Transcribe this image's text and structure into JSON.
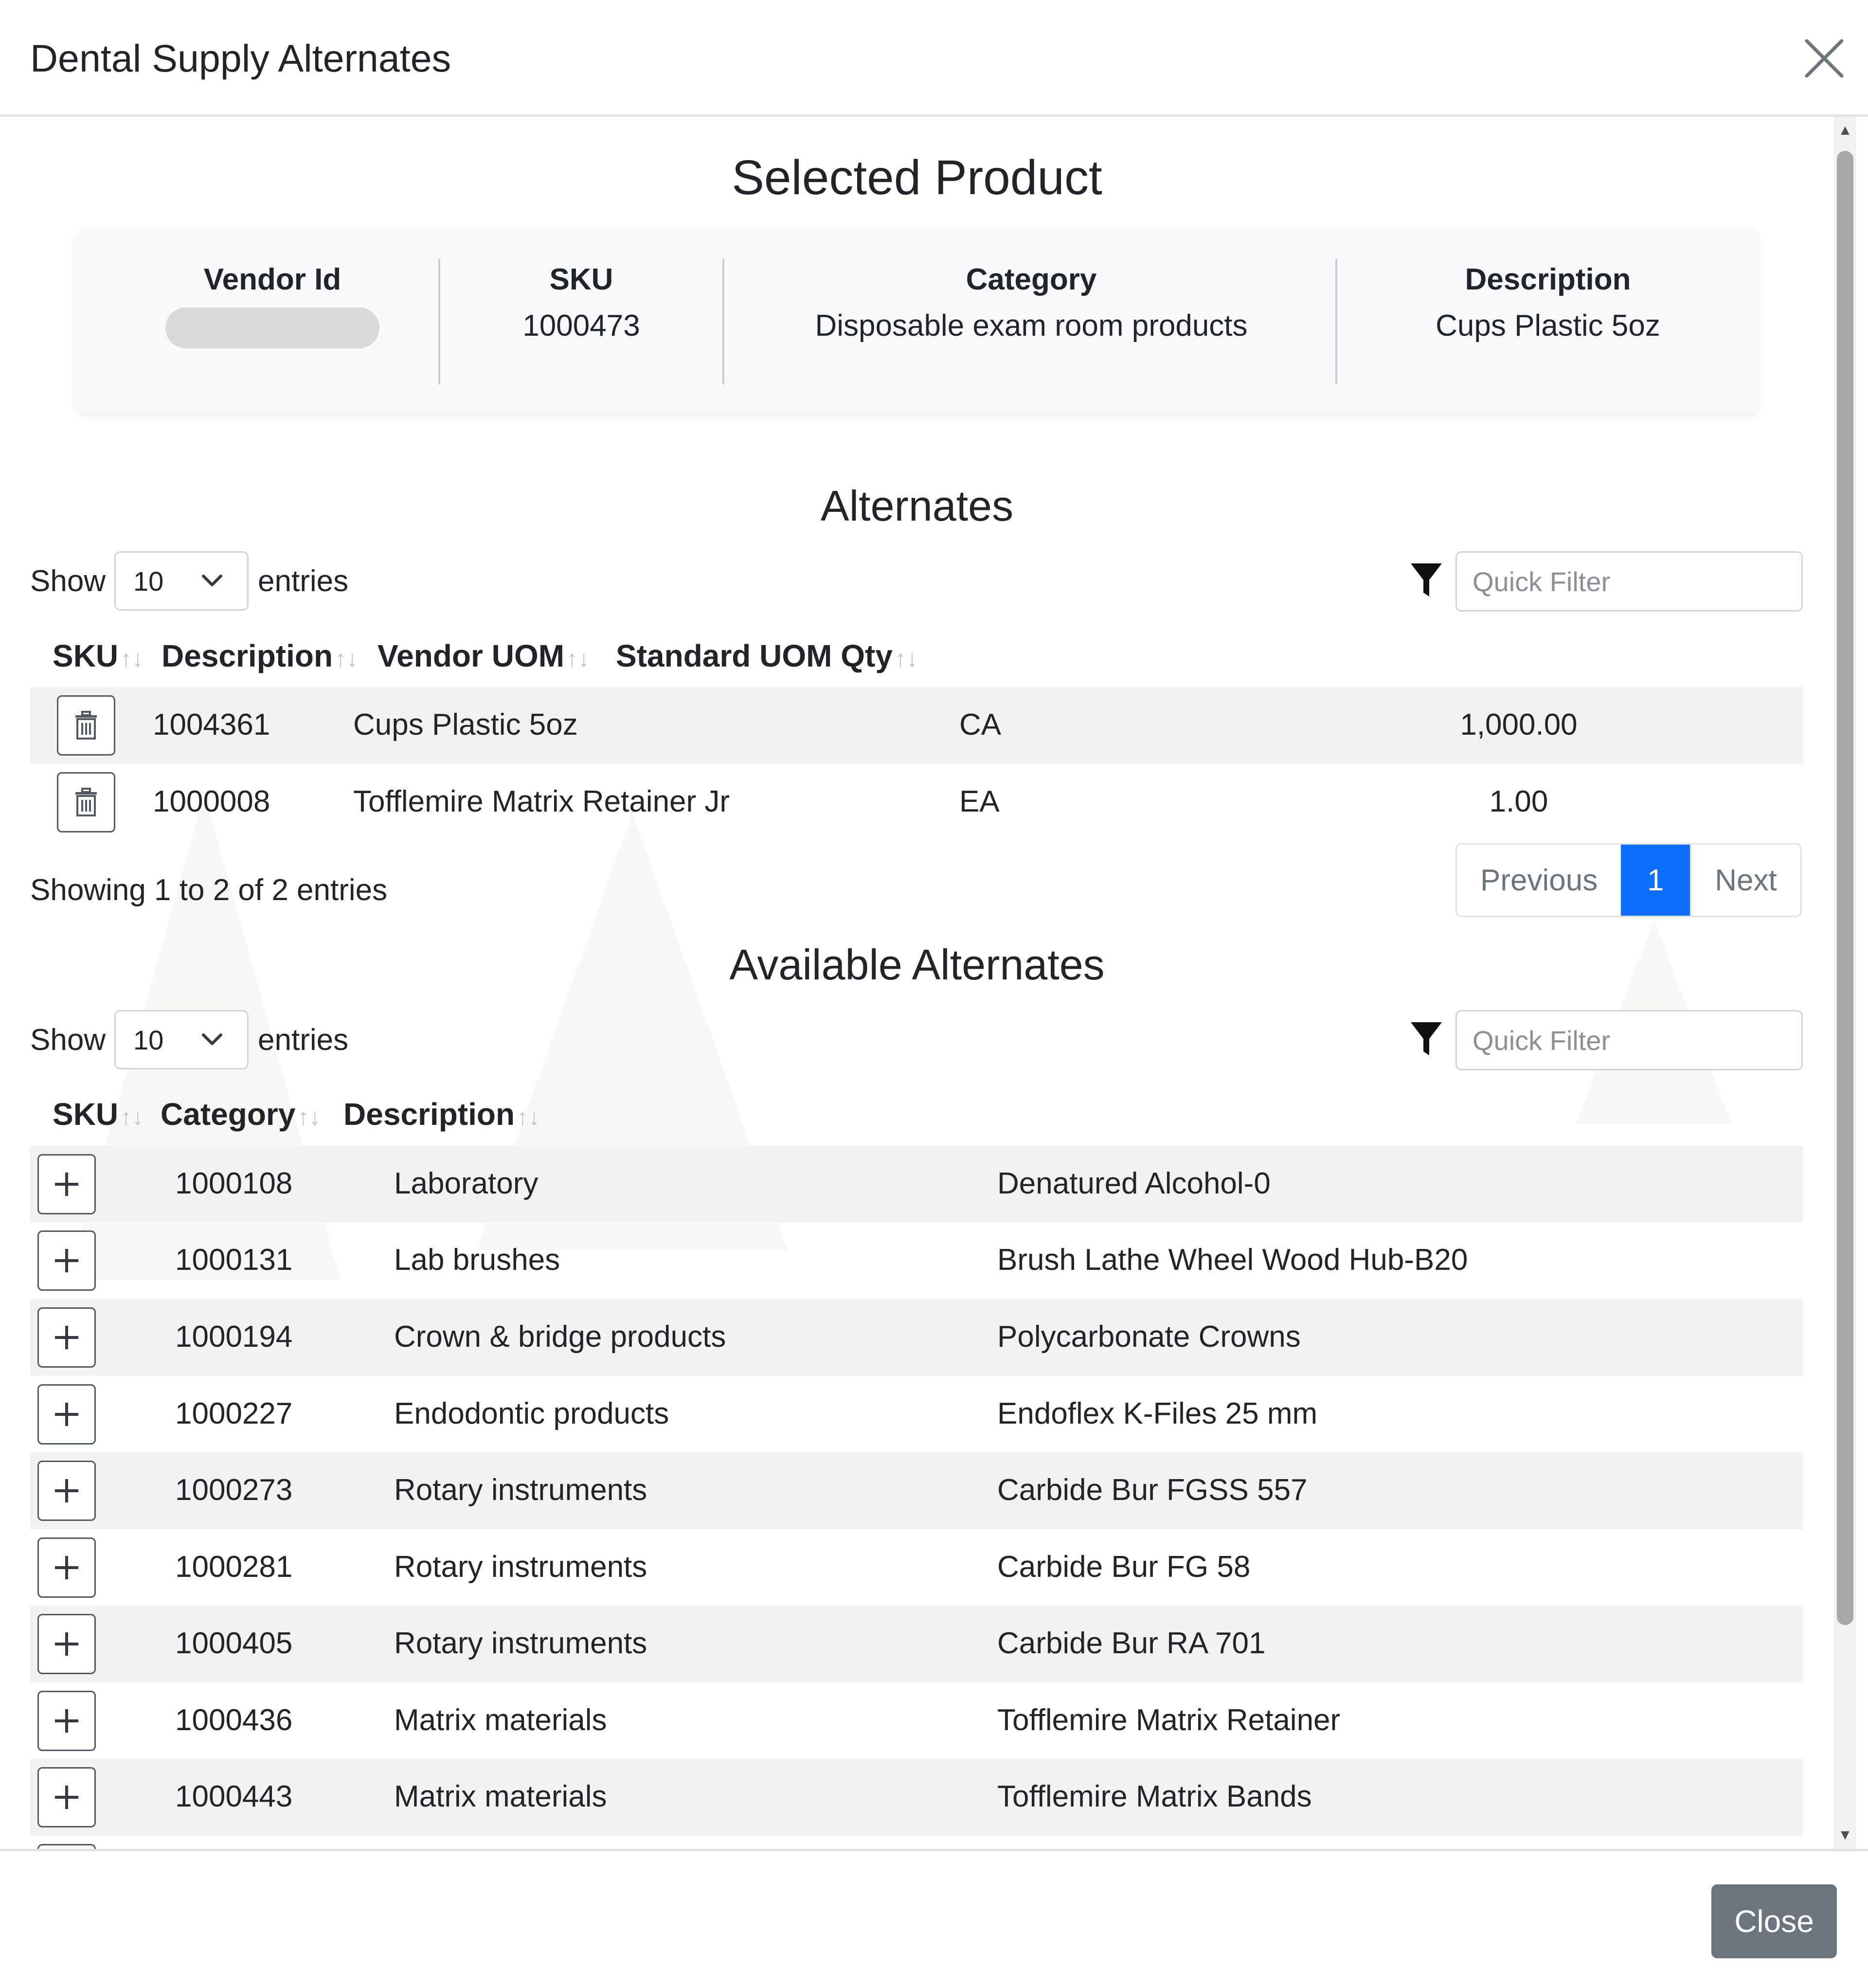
{
  "modal": {
    "title": "Dental Supply Alternates",
    "close_label": "Close"
  },
  "selected_product": {
    "heading": "Selected Product",
    "vendor_id_label": "Vendor Id",
    "vendor_id_value": "",
    "sku_label": "SKU",
    "sku_value": "1000473",
    "category_label": "Category",
    "category_value": "Disposable exam room products",
    "description_label": "Description",
    "description_value": "Cups Plastic 5oz"
  },
  "alternates": {
    "heading": "Alternates",
    "show_label": "Show",
    "entries_label": "entries",
    "page_size": "10",
    "filter_placeholder": "Quick Filter",
    "columns": [
      "SKU",
      "Description",
      "Vendor UOM",
      "Standard UOM Qty"
    ],
    "rows": [
      {
        "sku": "1004361",
        "description": "Cups Plastic 5oz",
        "vendor_uom": "CA",
        "std_uom_qty": "1,000.00"
      },
      {
        "sku": "1000008",
        "description": "Tofflemire Matrix Retainer Jr",
        "vendor_uom": "EA",
        "std_uom_qty": "1.00"
      }
    ],
    "info": "Showing 1 to 2 of 2 entries",
    "pagination": {
      "previous": "Previous",
      "current": "1",
      "next": "Next"
    }
  },
  "available_alternates": {
    "heading": "Available Alternates",
    "show_label": "Show",
    "entries_label": "entries",
    "page_size": "10",
    "filter_placeholder": "Quick Filter",
    "columns": [
      "SKU",
      "Category",
      "Description"
    ],
    "rows": [
      {
        "sku": "1000108",
        "category": "Laboratory",
        "description": "Denatured Alcohol-0"
      },
      {
        "sku": "1000131",
        "category": "Lab brushes",
        "description": "Brush Lathe Wheel Wood Hub-B20"
      },
      {
        "sku": "1000194",
        "category": "Crown & bridge products",
        "description": "Polycarbonate Crowns"
      },
      {
        "sku": "1000227",
        "category": "Endodontic products",
        "description": "Endoflex K-Files 25 mm"
      },
      {
        "sku": "1000273",
        "category": "Rotary instruments",
        "description": "Carbide Bur FGSS 557"
      },
      {
        "sku": "1000281",
        "category": "Rotary instruments",
        "description": "Carbide Bur FG 58"
      },
      {
        "sku": "1000405",
        "category": "Rotary instruments",
        "description": "Carbide Bur RA 701"
      },
      {
        "sku": "1000436",
        "category": "Matrix materials",
        "description": "Tofflemire Matrix Retainer"
      },
      {
        "sku": "1000443",
        "category": "Matrix materials",
        "description": "Tofflemire Matrix Bands"
      }
    ]
  },
  "icons": {
    "close": "close-icon",
    "filter": "filter-icon",
    "delete": "trash-icon",
    "add": "plus-icon",
    "sort": "sort-icon",
    "dropdown": "chevron-down-icon"
  },
  "colors": {
    "primary": "#0d6efd",
    "secondary_button": "#6c757d",
    "stripe": "#f2f2f2",
    "card": "#f8f9fa"
  }
}
